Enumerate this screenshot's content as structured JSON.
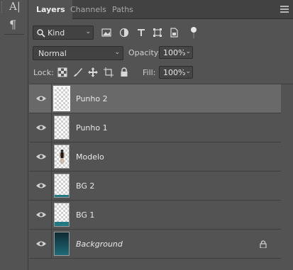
{
  "tabs": [
    {
      "label": "Layers",
      "active": true
    },
    {
      "label": "Channels",
      "active": false
    },
    {
      "label": "Paths",
      "active": false
    }
  ],
  "left_toolbar": {
    "icons": [
      "character-icon",
      "paragraph-icon"
    ],
    "glyph1": "A|",
    "glyph2": "¶"
  },
  "filter": {
    "kind_label": "Kind"
  },
  "blend": {
    "mode": "Normal",
    "opacity_label": "Opacity:",
    "opacity_value": "100%"
  },
  "lock": {
    "label": "Lock:",
    "fill_label": "Fill:",
    "fill_value": "100%"
  },
  "layers": [
    {
      "name": "Punho 2",
      "visible": true,
      "selected": true,
      "thumb": "transparent"
    },
    {
      "name": "Punho 1",
      "visible": true,
      "selected": false,
      "thumb": "transparent"
    },
    {
      "name": "Modelo",
      "visible": true,
      "selected": false,
      "thumb": "figure"
    },
    {
      "name": "BG 2",
      "visible": true,
      "selected": false,
      "thumb": "transparent-teal"
    },
    {
      "name": "BG 1",
      "visible": true,
      "selected": false,
      "thumb": "transparent-teal"
    },
    {
      "name": "Background",
      "visible": true,
      "selected": false,
      "thumb": "background",
      "locked": true
    }
  ],
  "colors": {
    "panel": "#535353",
    "tabbar": "#424242",
    "selected_row": "#696969",
    "teal": "#1f7a84"
  }
}
